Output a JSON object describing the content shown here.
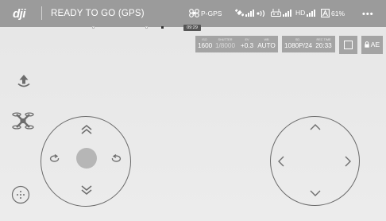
{
  "topbar": {
    "logo": "dji",
    "status": "READY TO GO (GPS)",
    "gps_mode": "P-GPS",
    "hd_label": "HD",
    "battery_percent": "61%",
    "more_label": "•••"
  },
  "flight_time": "09:29",
  "camera": {
    "params": [
      {
        "key": "ISO",
        "value": "1600"
      },
      {
        "key": "SHUTTER",
        "value": "1/8000"
      },
      {
        "key": "EV",
        "value": "+0.3"
      },
      {
        "key": "WB",
        "value": "AUTO"
      }
    ],
    "format": {
      "key": "SD",
      "value": "1080P/24"
    },
    "time": {
      "key": "REC TIME",
      "value": "20:33"
    },
    "ae_label": "AE"
  },
  "colors": {
    "topbar_bg": "#9b9b9b",
    "screen_bg": "#e8e8e8",
    "panel_bg": "#a4a4a4",
    "line": "#6d6d6d"
  },
  "icons": {
    "takeoff": "takeoff-icon",
    "drone_mode": "drone-mode-icon",
    "camera": "camera-icon"
  }
}
